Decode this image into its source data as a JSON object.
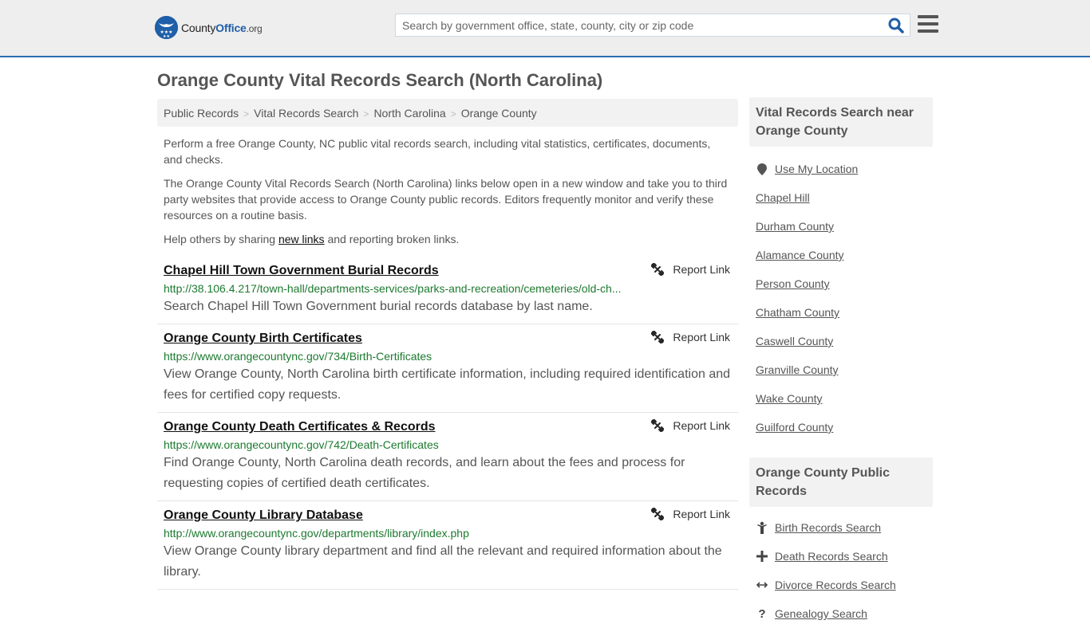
{
  "header": {
    "logo": {
      "name_part1": "County",
      "name_part2": "Office",
      "name_part3": ".org"
    },
    "search_placeholder": "Search by government office, state, county, city or zip code",
    "search_value": ""
  },
  "page": {
    "title": "Orange County Vital Records Search (North Carolina)"
  },
  "breadcrumb": [
    {
      "label": "Public Records"
    },
    {
      "label": "Vital Records Search"
    },
    {
      "label": "North Carolina"
    },
    {
      "label": "Orange County"
    }
  ],
  "intro": {
    "p1": "Perform a free Orange County, NC public vital records search, including vital statistics, certificates, documents, and checks.",
    "p2": "The Orange County Vital Records Search (North Carolina) links below open in a new window and take you to third party websites that provide access to Orange County public records. Editors frequently monitor and verify these resources on a routine basis.",
    "p3_before": "Help others by sharing ",
    "p3_link": "new links",
    "p3_after": " and reporting broken links."
  },
  "report_label": "Report Link",
  "results": [
    {
      "title": "Chapel Hill Town Government Burial Records",
      "url": "http://38.106.4.217/town-hall/departments-services/parks-and-recreation/cemeteries/old-ch...",
      "description": "Search Chapel Hill Town Government burial records database by last name."
    },
    {
      "title": "Orange County Birth Certificates",
      "url": "https://www.orangecountync.gov/734/Birth-Certificates",
      "description": "View Orange County, North Carolina birth certificate information, including required identification and fees for certified copy requests."
    },
    {
      "title": "Orange County Death Certificates & Records",
      "url": "https://www.orangecountync.gov/742/Death-Certificates",
      "description": "Find Orange County, North Carolina death records, and learn about the fees and process for requesting copies of certified death certificates."
    },
    {
      "title": "Orange County Library Database",
      "url": "http://www.orangecountync.gov/departments/library/index.php",
      "description": "View Orange County library department and find all the relevant and required information about the library."
    }
  ],
  "sidebar": {
    "nearby": {
      "heading": "Vital Records Search near Orange County",
      "use_location": "Use My Location",
      "items": [
        "Chapel Hill",
        "Durham County",
        "Alamance County",
        "Person County",
        "Chatham County",
        "Caswell County",
        "Granville County",
        "Wake County",
        "Guilford County"
      ]
    },
    "public_records": {
      "heading": "Orange County Public Records",
      "items": [
        {
          "label": "Birth Records Search",
          "icon": "child-icon"
        },
        {
          "label": "Death Records Search",
          "icon": "plus-icon"
        },
        {
          "label": "Divorce Records Search",
          "icon": "arrows-horizontal-icon"
        },
        {
          "label": "Genealogy Search",
          "icon": "question-icon"
        }
      ]
    }
  }
}
